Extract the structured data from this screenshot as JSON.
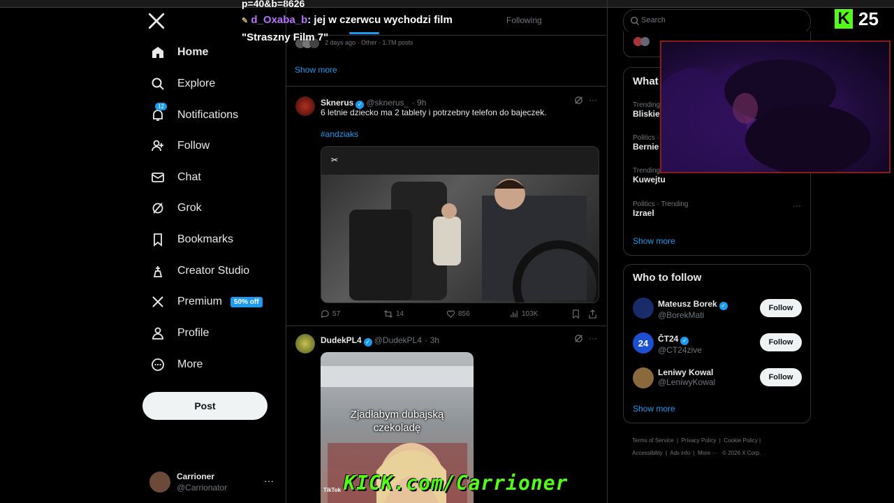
{
  "overlay": {
    "url_fragment": "p=40&b=8626",
    "chat": {
      "user": "d_Oxaba_b",
      "line1": ": jej w czerwcu wychodzi film",
      "line2": "\"Straszny Film 7\""
    },
    "kick_count": "25",
    "kick_url": "KICK.com/Carrioner"
  },
  "sidebar": {
    "items": [
      {
        "label": "Home",
        "icon": "home-icon"
      },
      {
        "label": "Explore",
        "icon": "search-icon"
      },
      {
        "label": "Notifications",
        "icon": "bell-icon",
        "badge": "12"
      },
      {
        "label": "Follow",
        "icon": "add-person-icon"
      },
      {
        "label": "Chat",
        "icon": "mail-icon"
      },
      {
        "label": "Grok",
        "icon": "grok-icon"
      },
      {
        "label": "Bookmarks",
        "icon": "bookmark-icon"
      },
      {
        "label": "Creator Studio",
        "icon": "creator-icon"
      },
      {
        "label": "Premium",
        "icon": "x-icon",
        "promo": "50% off"
      },
      {
        "label": "Profile",
        "icon": "person-icon"
      },
      {
        "label": "More",
        "icon": "more-circle-icon"
      }
    ],
    "post_label": "Post",
    "account": {
      "name": "Carrioner",
      "handle": "@Carrionator"
    }
  },
  "main": {
    "tab_following": "Following",
    "trend_meta": "2 days ago · Other · 1.7M posts",
    "show_more": "Show more",
    "tweets": [
      {
        "name": "Sknerus",
        "handle": "@sknerus_",
        "time": "· 9h",
        "text": "6 letnie dziecko ma 2 tablety i potrzebny telefon do bajeczek.",
        "tag": "#andziaks",
        "replies": "57",
        "reposts": "14",
        "likes": "856",
        "views": "103K"
      },
      {
        "name": "DudekPL4",
        "handle": "@DudekPL4",
        "time": "· 3h",
        "media_caption_1": "Zjadłabym dubajską",
        "media_caption_2": "czekoladę",
        "media_watermark": "TikTok"
      }
    ]
  },
  "right": {
    "search_placeholder": "Search",
    "whats_happening": "What",
    "trends": [
      {
        "category": "Trending",
        "name": "Bliskie"
      },
      {
        "category": "Politics ·",
        "name": "Bernie"
      },
      {
        "category": "Trending in Poland",
        "name": "Kuwejtu"
      },
      {
        "category": "Politics · Trending",
        "name": "Izrael"
      }
    ],
    "trends_show_more": "Show more",
    "who_to_follow_title": "Who to follow",
    "who_to_follow": [
      {
        "name": "Mateusz Borek",
        "handle": "@BorekMati",
        "button": "Follow",
        "avatar_color": "#1b2a6b"
      },
      {
        "name": "ČT24",
        "handle": "@CT24zive",
        "button": "Follow",
        "avatar_color": "#1d4fd1"
      },
      {
        "name": "Leniwy Kowal",
        "handle": "@LeniwyKowal",
        "button": "Follow",
        "avatar_color": "#8a6a3c"
      }
    ],
    "wtf_show_more": "Show more",
    "footer": {
      "terms": "Terms of Service",
      "privacy": "Privacy Policy",
      "cookie": "Cookie Policy",
      "accessibility": "Accessibility",
      "ads": "Ads info",
      "more": "More ···",
      "copyright": "© 2026 X Corp."
    }
  },
  "colors": {
    "accent": "#1d9bf0",
    "kick_green": "#53fc18"
  }
}
